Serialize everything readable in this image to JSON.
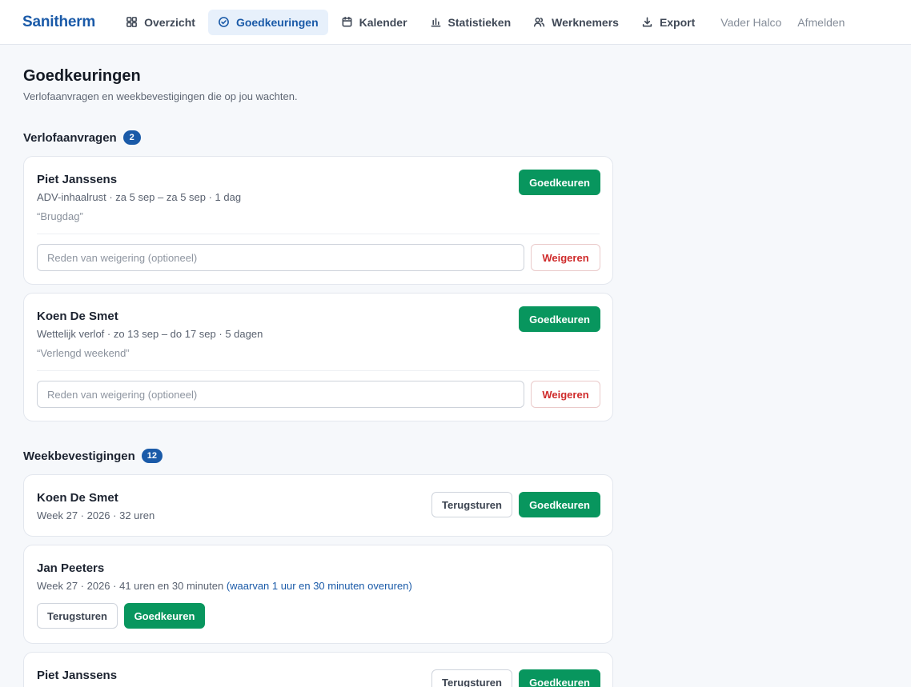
{
  "app": {
    "brand": "Sanitherm",
    "user": "Vader Halco",
    "logout": "Afmelden"
  },
  "nav": [
    {
      "label": "Overzicht",
      "icon": "grid-icon",
      "active": false
    },
    {
      "label": "Goedkeuringen",
      "icon": "check-circle-icon",
      "active": true
    },
    {
      "label": "Kalender",
      "icon": "calendar-icon",
      "active": false
    },
    {
      "label": "Statistieken",
      "icon": "bar-chart-icon",
      "active": false
    },
    {
      "label": "Werknemers",
      "icon": "users-icon",
      "active": false
    },
    {
      "label": "Export",
      "icon": "download-icon",
      "active": false
    }
  ],
  "page": {
    "title": "Goedkeuringen",
    "subtitle": "Verlofaanvragen en weekbevestigingen die op jou wachten."
  },
  "leave": {
    "heading": "Verlofaanvragen",
    "count": "2",
    "reason_placeholder": "Reden van weigering (optioneel)",
    "approve_label": "Goedkeuren",
    "reject_label": "Weigeren",
    "requests": [
      {
        "name": "Piet Janssens",
        "meta": "ADV-inhaalrust · za 5 sep – za 5 sep · 1 dag",
        "note": "“Brugdag”"
      },
      {
        "name": "Koen De Smet",
        "meta": "Wettelijk verlof · zo 13 sep – do 17 sep · 5 dagen",
        "note": "“Verlengd weekend”"
      }
    ]
  },
  "weeks": {
    "heading": "Weekbevestigingen",
    "count": "12",
    "return_label": "Terugsturen",
    "approve_label": "Goedkeuren",
    "items": [
      {
        "name": "Koen De Smet",
        "meta": "Week 27 · 2026 · 32 uren",
        "overtime": ""
      },
      {
        "name": "Jan Peeters",
        "meta": "Week 27 · 2026 · 41 uren en 30 minuten",
        "overtime": "(waarvan 1 uur en 30 minuten overuren)"
      },
      {
        "name": "Piet Janssens",
        "meta": "",
        "overtime": ""
      }
    ]
  },
  "colors": {
    "brand": "#1a5aa8",
    "approve": "#08965e",
    "reject": "#cf2b2b",
    "background": "#f6f8fb"
  }
}
